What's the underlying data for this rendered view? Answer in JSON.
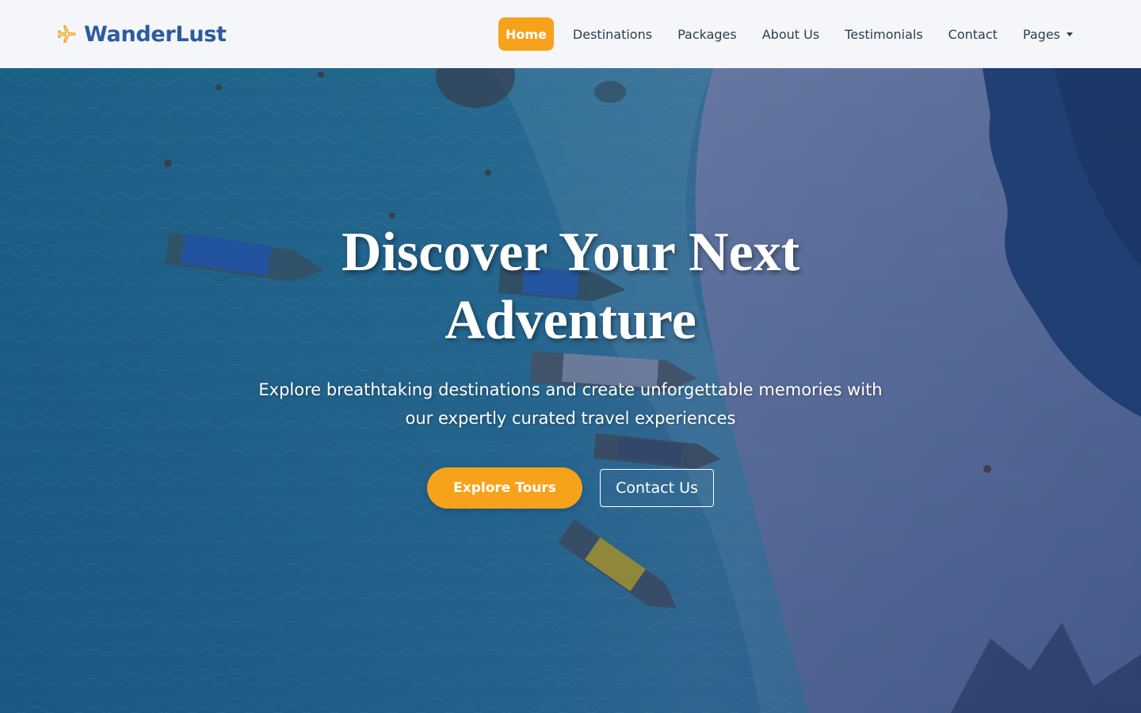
{
  "brand": {
    "name": "WanderLust",
    "icon": "airplane-icon",
    "color": "#2d5aa0",
    "icon_color": "#f7a21b"
  },
  "nav": {
    "items": [
      {
        "label": "Home",
        "active": true
      },
      {
        "label": "Destinations",
        "active": false
      },
      {
        "label": "Packages",
        "active": false
      },
      {
        "label": "About Us",
        "active": false
      },
      {
        "label": "Testimonials",
        "active": false
      },
      {
        "label": "Contact",
        "active": false
      },
      {
        "label": "Pages",
        "active": false,
        "dropdown": true
      }
    ],
    "accent": "#f7a21b"
  },
  "hero": {
    "title": "Discover Your Next Adventure",
    "subtitle": "Explore breathtaking destinations and create unforgettable memories with our expertly curated travel experiences",
    "primary_button": "Explore Tours",
    "secondary_button": "Contact Us",
    "background": "aerial-beach-boats-photo"
  }
}
